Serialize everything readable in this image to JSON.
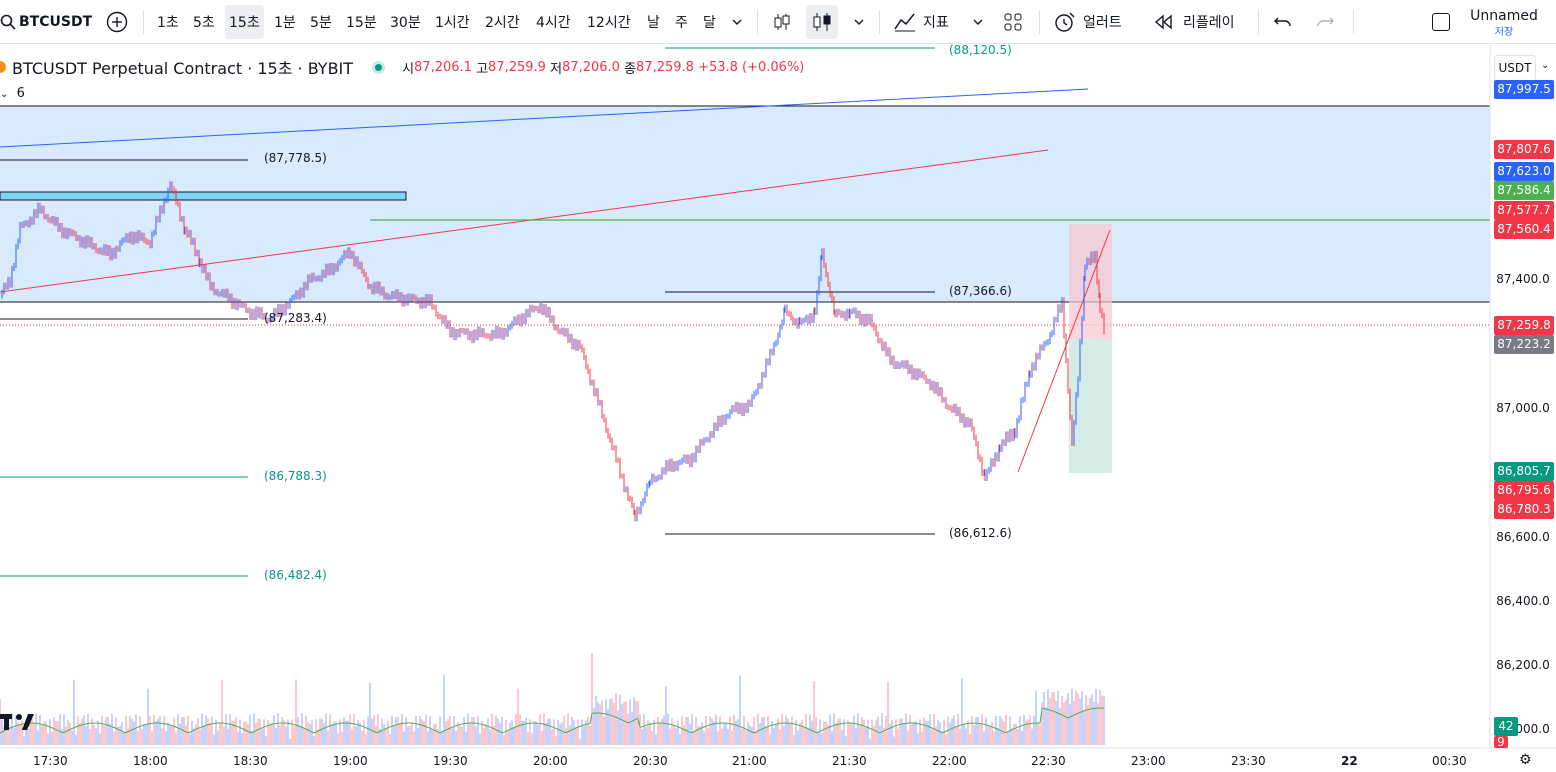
{
  "toolbar": {
    "symbol": "BTCUSDT",
    "intervals": [
      "1초",
      "5초",
      "15초",
      "1분",
      "5분",
      "15분",
      "30분",
      "1시간",
      "2시간",
      "4시간",
      "12시간",
      "날",
      "주",
      "달"
    ],
    "active_interval": "15초",
    "indicators_label": "지표",
    "alert_label": "얼러트",
    "replay_label": "리플레이",
    "layout_name": "Unnamed",
    "save_label": "저장"
  },
  "legend": {
    "title": "BTCUSDT Perpetual Contract · 15초 · BYBIT",
    "o_label": "시",
    "o": "87,206.1",
    "h_label": "고",
    "h": "87,259.9",
    "l_label": "저",
    "l": "87,206.0",
    "c_label": "종",
    "c": "87,259.8",
    "change": "+53.8 (+0.06%)",
    "collapse_count": "6"
  },
  "price_axis": {
    "currency": "USDT",
    "ticks": [
      "87,400.0",
      "87,000.0",
      "86,600.0",
      "86,400.0",
      "86,200.0",
      "86,000.0"
    ],
    "badges": [
      {
        "text": "87,997.5",
        "color": "#2962ff"
      },
      {
        "text": "87,807.6",
        "color": "#f23645"
      },
      {
        "text": "87,623.0",
        "color": "#2962ff"
      },
      {
        "text": "87,586.4",
        "color": "#4caf50"
      },
      {
        "text": "87,577.7",
        "color": "#f23645"
      },
      {
        "text": "87,560.4",
        "color": "#f23645"
      },
      {
        "text": "87,259.8",
        "color": "#f23645"
      },
      {
        "text": "87,223.2",
        "color": "#787b86"
      },
      {
        "text": "86,805.7",
        "color": "#089981"
      },
      {
        "text": "86,795.6",
        "color": "#f23645"
      },
      {
        "text": "86,780.3",
        "color": "#f23645"
      },
      {
        "text": "42",
        "color": "#089981"
      },
      {
        "text": "9",
        "color": "#f23645"
      }
    ]
  },
  "time_axis": [
    "17:30",
    "18:00",
    "18:30",
    "19:00",
    "19:30",
    "20:00",
    "20:30",
    "21:00",
    "21:30",
    "22:00",
    "22:30",
    "23:00",
    "23:30",
    "22",
    "00:30"
  ],
  "annotations": {
    "top": "(88,120.5)",
    "h1": "(87,778.5)",
    "h2": "(87,283.4)",
    "h3": "(87,366.6)",
    "l1": "(86,788.3)",
    "l2": "(86,482.4)",
    "l3": "(86,612.6)"
  },
  "chart_data": {
    "type": "candlestick",
    "symbol": "BTCUSDT",
    "x": [
      "17:30",
      "18:00",
      "18:30",
      "19:00",
      "19:30",
      "20:00",
      "20:30",
      "21:00",
      "21:30",
      "22:00",
      "22:30"
    ],
    "close": [
      87500,
      87700,
      87300,
      87400,
      87250,
      87300,
      86700,
      87100,
      87300,
      86900,
      87260
    ],
    "levels": [
      88120.5,
      87778.5,
      87366.6,
      87283.4,
      86788.3,
      86612.6,
      86482.4
    ]
  },
  "colors": {
    "up": "#089981",
    "down": "#f23645",
    "accent": "#2962ff"
  }
}
